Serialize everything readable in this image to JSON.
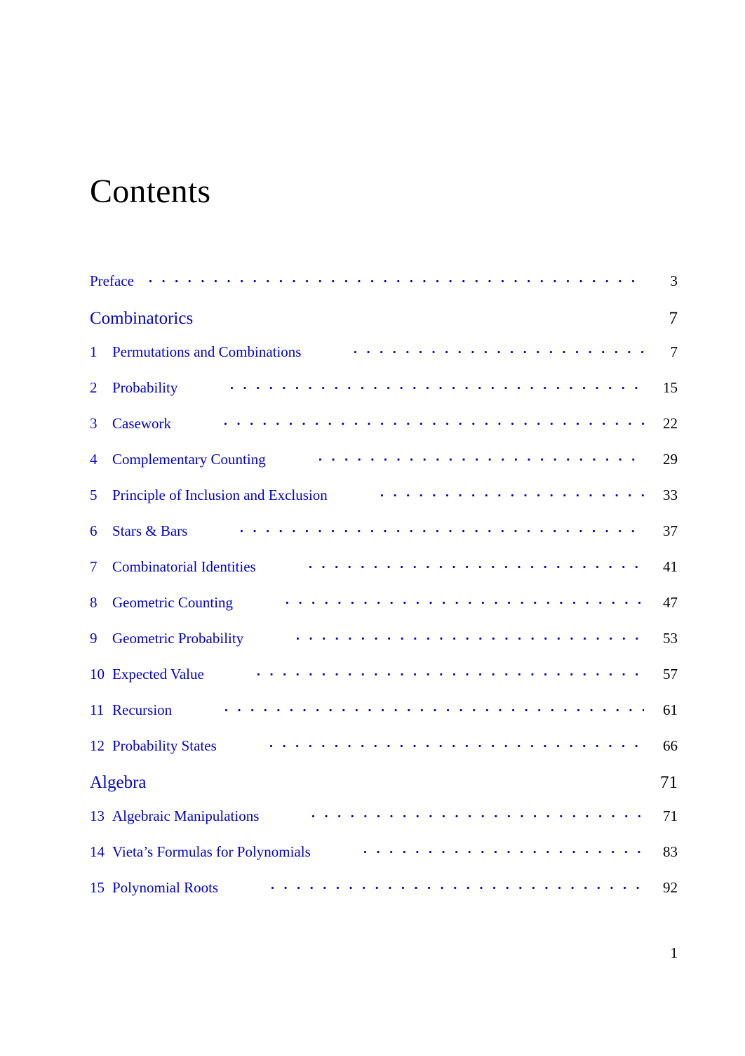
{
  "document": {
    "heading": "Contents",
    "folio": "1"
  },
  "front_matter": [
    {
      "title": "Preface",
      "page": "3"
    }
  ],
  "parts": [
    {
      "name": "Combinatorics",
      "page": "7",
      "chapters": [
        {
          "num": "1",
          "title": "Permutations and Combinations",
          "page": "7"
        },
        {
          "num": "2",
          "title": "Probability",
          "page": "15"
        },
        {
          "num": "3",
          "title": "Casework",
          "page": "22"
        },
        {
          "num": "4",
          "title": "Complementary Counting",
          "page": "29"
        },
        {
          "num": "5",
          "title": "Principle of Inclusion and Exclusion",
          "page": "33"
        },
        {
          "num": "6",
          "title": "Stars & Bars",
          "page": "37"
        },
        {
          "num": "7",
          "title": "Combinatorial Identities",
          "page": "41"
        },
        {
          "num": "8",
          "title": "Geometric Counting",
          "page": "47"
        },
        {
          "num": "9",
          "title": "Geometric Probability",
          "page": "53"
        },
        {
          "num": "10",
          "title": "Expected Value",
          "page": "57"
        },
        {
          "num": "11",
          "title": "Recursion",
          "page": "61"
        },
        {
          "num": "12",
          "title": "Probability States",
          "page": "66"
        }
      ]
    },
    {
      "name": "Algebra",
      "page": "71",
      "chapters": [
        {
          "num": "13",
          "title": "Algebraic Manipulations",
          "page": "71"
        },
        {
          "num": "14",
          "title": "Vieta’s Formulas for Polynomials",
          "page": "83"
        },
        {
          "num": "15",
          "title": "Polynomial Roots",
          "page": "92"
        }
      ]
    }
  ],
  "colors": {
    "link": "#0000d2",
    "text": "#000000",
    "background": "#ffffff"
  }
}
